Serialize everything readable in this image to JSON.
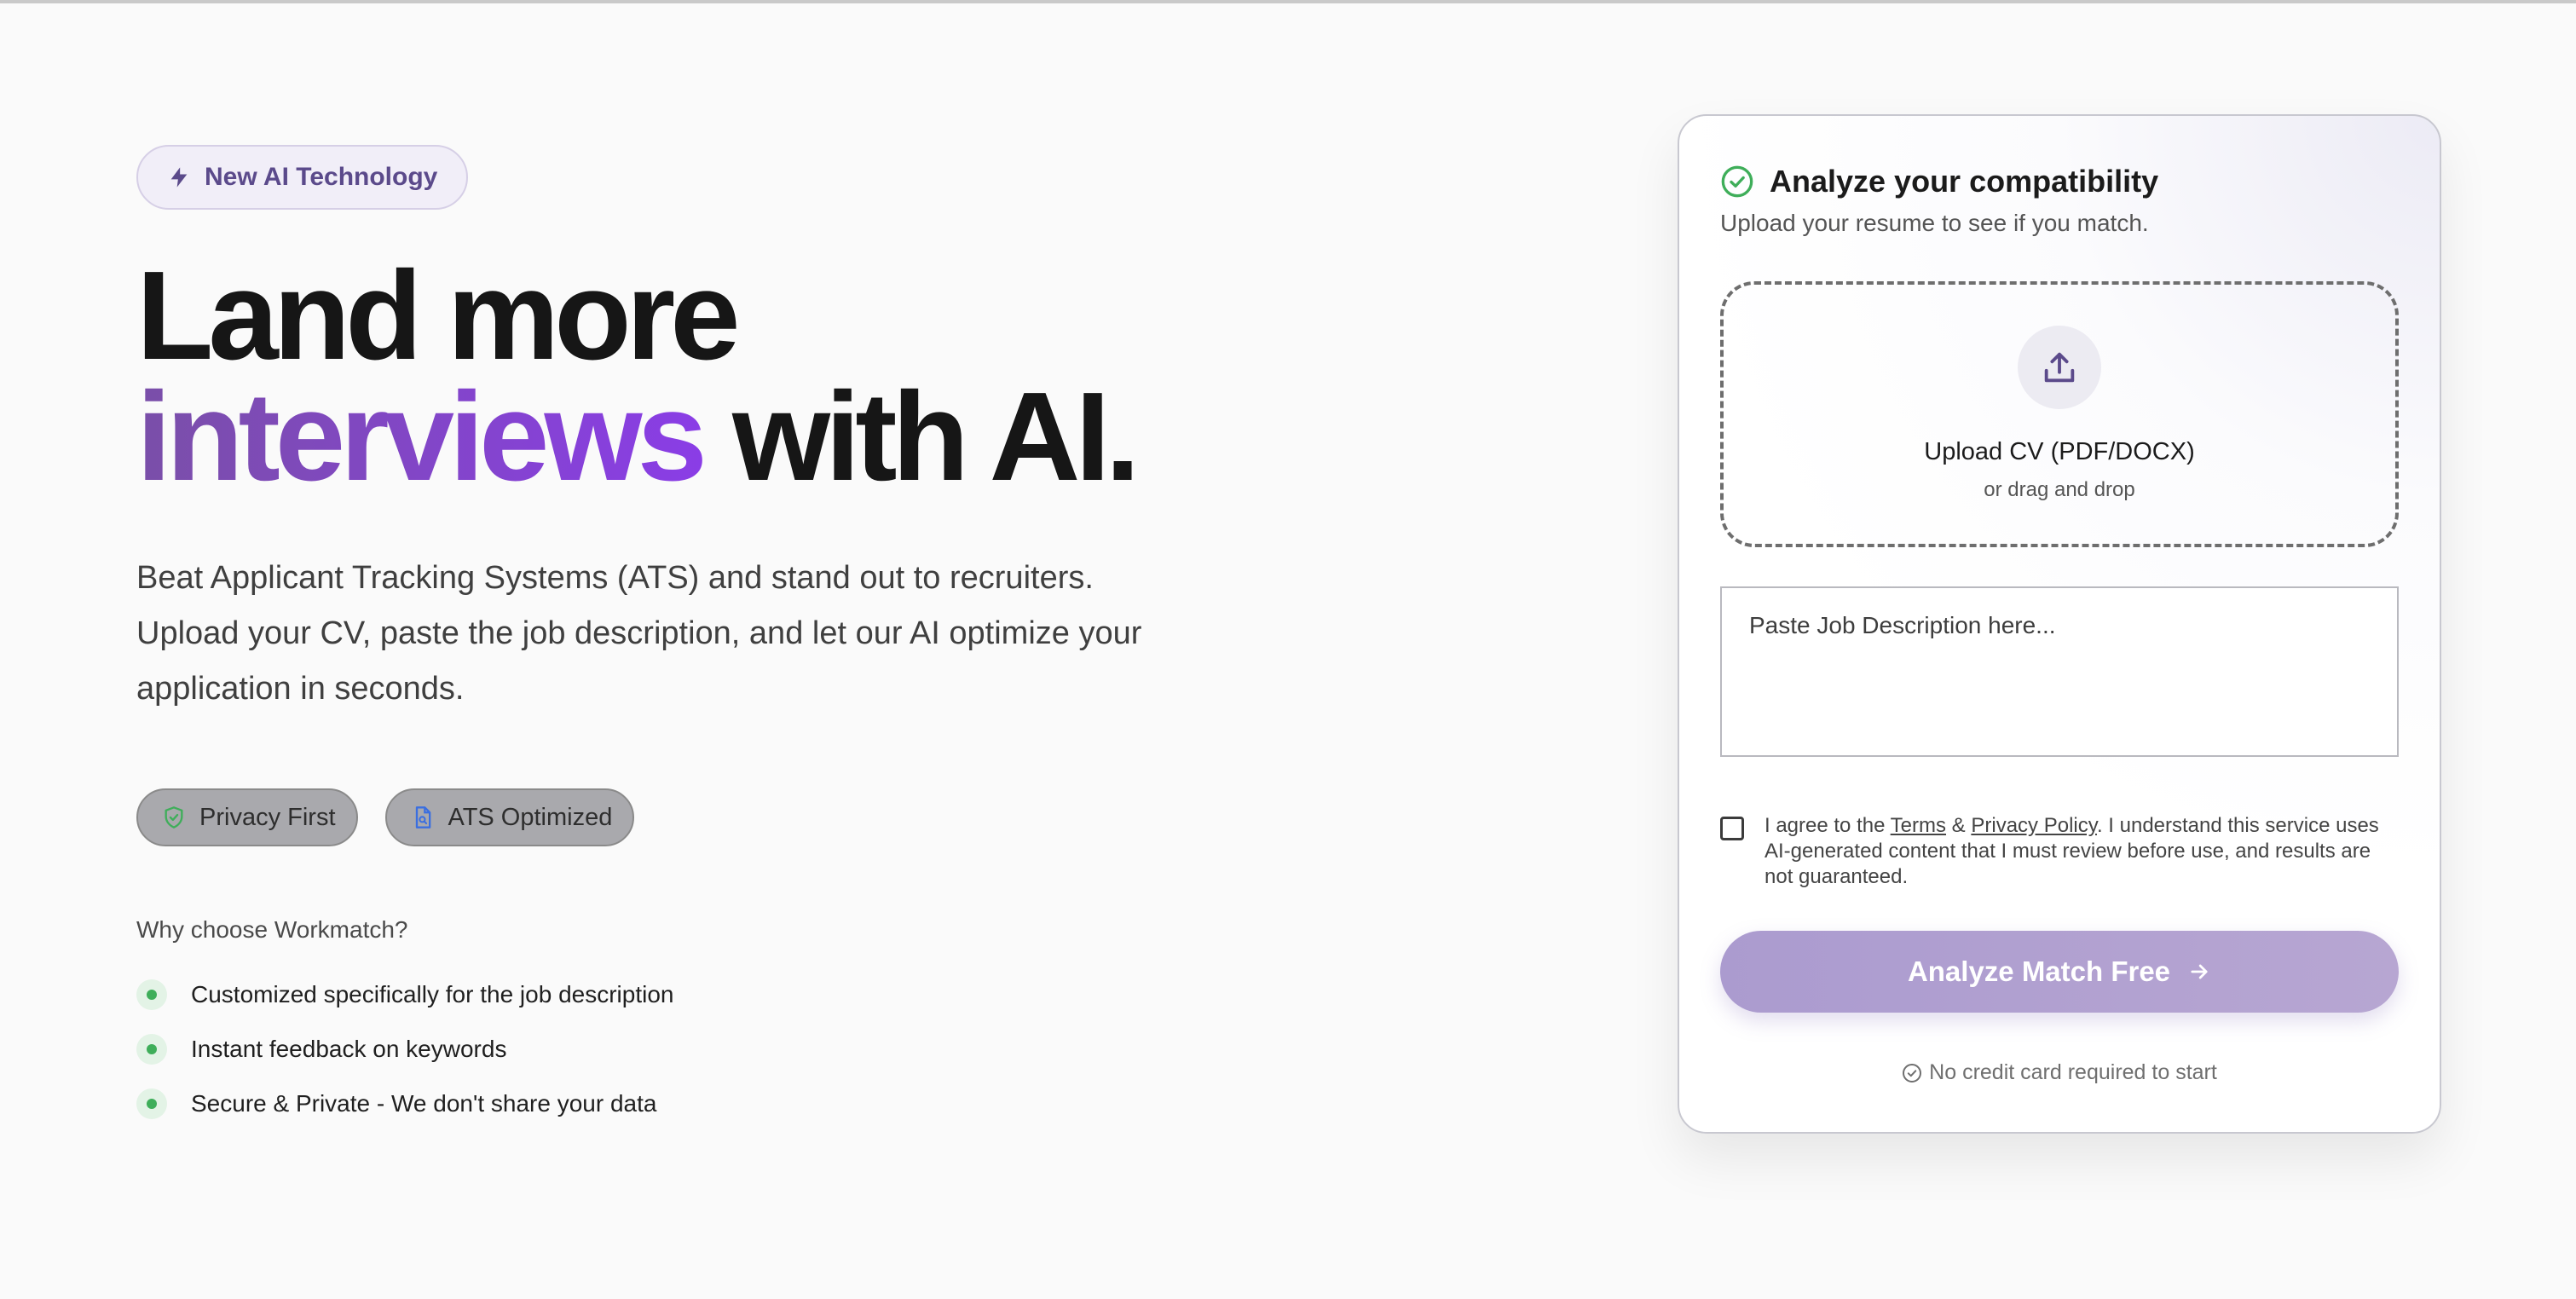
{
  "hero": {
    "badge_label": "New AI Technology",
    "headline_line1": "Land more",
    "headline_highlight": "interviews",
    "headline_rest": " with AI.",
    "subtitle": "Beat Applicant Tracking Systems (ATS) and stand out to recruiters. Upload your CV, paste the job description, and let our AI optimize your application in seconds.",
    "pills": [
      "Privacy First",
      "ATS Optimized"
    ],
    "why_title": "Why choose Workmatch?",
    "why_items": [
      "Customized specifically for the job description",
      "Instant feedback on keywords",
      "Secure & Private - We don't share your data"
    ]
  },
  "card": {
    "title": "Analyze your compatibility",
    "subtitle": "Upload your resume to see if you match.",
    "upload_title": "Upload CV (PDF/DOCX)",
    "upload_sub": "or drag and drop",
    "jd_placeholder": "Paste Job Description here...",
    "agree_prefix": "I agree to the ",
    "terms_link": "Terms",
    "agree_amp": " & ",
    "privacy_link": "Privacy Policy",
    "agree_suffix": ". I understand this service uses AI-generated content that I must review before use, and results are not guaranteed.",
    "cta_label": "Analyze Match Free",
    "no_credit": "No credit card required to start"
  },
  "colors": {
    "accent": "#8a3de6",
    "accent_soft": "#ab9bcf",
    "success": "#3fae5a"
  }
}
